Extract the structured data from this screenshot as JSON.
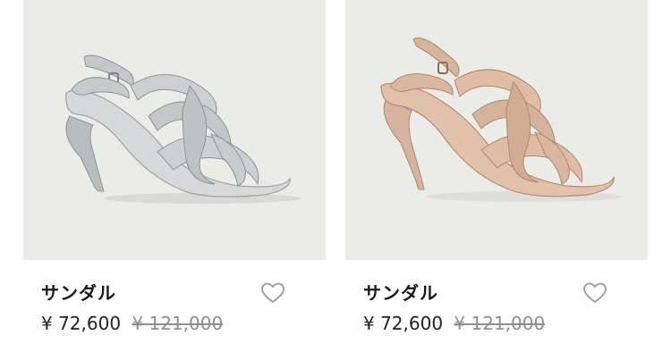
{
  "products": [
    {
      "name": "サンダル",
      "sale_price": "¥ 72,600",
      "original_price": "¥ 121,000",
      "image_alt": "silver sandal",
      "color": "#c9cbcd"
    },
    {
      "name": "サンダル",
      "sale_price": "¥ 72,600",
      "original_price": "¥ 121,000",
      "image_alt": "nude sandal",
      "color": "#dcb59c"
    }
  ],
  "icons": {
    "favorite": "heart-outline-icon"
  },
  "colors": {
    "image_background": "#ebebe8",
    "text": "#1a1a1a",
    "strikethrough_price": "#8e8e8e",
    "heart_outline": "#9a9a9a"
  }
}
